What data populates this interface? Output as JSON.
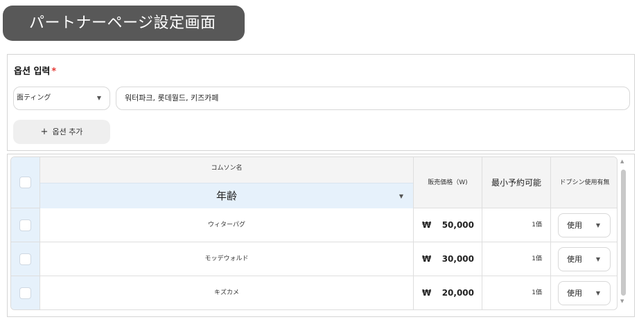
{
  "page": {
    "title": "パートナーページ設定画面"
  },
  "option_input": {
    "label": "옵션 입력",
    "required_mark": "*",
    "select_value": "面ティング",
    "values_text": "워터파크, 롯데월드, 키즈카페",
    "add_button_label": "옵션 추가"
  },
  "table": {
    "headers": {
      "column_name": "コムソン名",
      "filter_value": "年齢",
      "price": "販売価格（W)",
      "min_booking": "最小予約可能",
      "use_flag": "ドプシン使用有無"
    },
    "rows": [
      {
        "name": "ウィターパグ",
        "currency": "₩",
        "price": "50,000",
        "min": "1価",
        "use": "使用"
      },
      {
        "name": "モッデウォルド",
        "currency": "₩",
        "price": "30,000",
        "min": "1価",
        "use": "使用"
      },
      {
        "name": "キズカメ",
        "currency": "₩",
        "price": "20,000",
        "min": "1価",
        "use": "使用"
      }
    ]
  },
  "icons": {
    "dropdown": "chevron-down-icon",
    "add": "plus-icon",
    "scroll_up": "scroll-up-icon",
    "scroll_down": "scroll-down-icon"
  },
  "colors": {
    "title_bg": "#585858",
    "required": "#e53935",
    "row_highlight": "#e6f1fb"
  }
}
